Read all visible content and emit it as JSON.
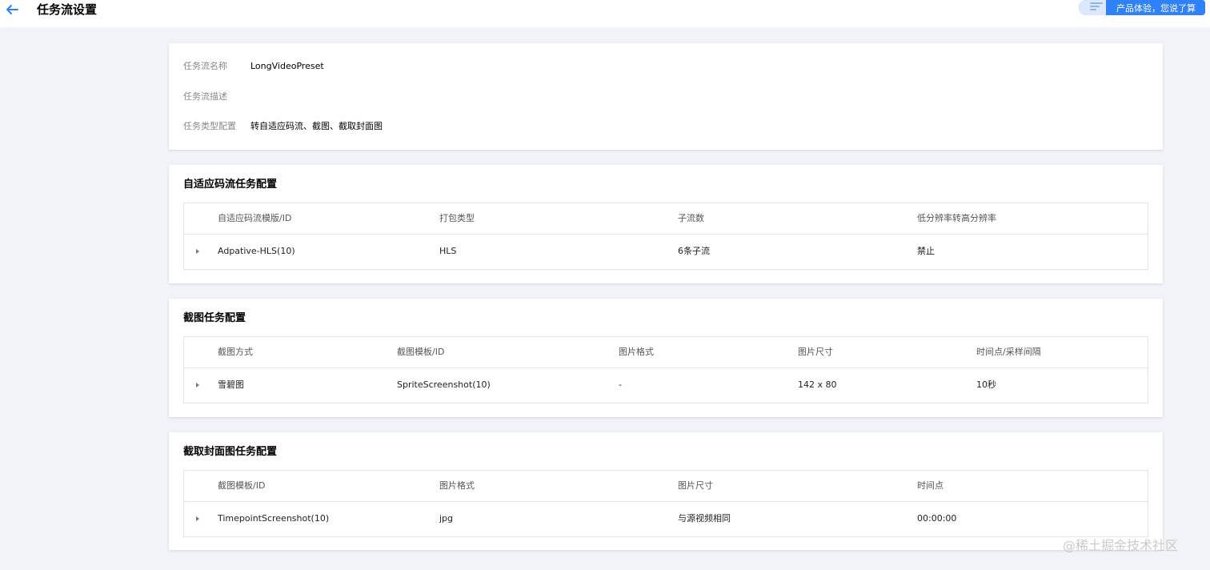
{
  "header": {
    "title": "任务流设置",
    "feedback_label": "产品体验，您说了算"
  },
  "info": {
    "rows": [
      {
        "label": "任务流名称",
        "value": "LongVideoPreset"
      },
      {
        "label": "任务流描述",
        "value": ""
      },
      {
        "label": "任务类型配置",
        "value": "转自适应码流、截图、截取封面图"
      }
    ]
  },
  "adaptive": {
    "title": "自适应码流任务配置",
    "columns": [
      "自适应码流模版/ID",
      "打包类型",
      "子流数",
      "低分辨率转高分辨率"
    ],
    "rows": [
      [
        "Adpative-HLS(10)",
        "HLS",
        "6条子流",
        "禁止"
      ]
    ]
  },
  "screenshot": {
    "title": "截图任务配置",
    "columns": [
      "截图方式",
      "截图模板/ID",
      "图片格式",
      "图片尺寸",
      "时间点/采样间隔"
    ],
    "rows": [
      [
        "雪碧图",
        "SpriteScreenshot(10)",
        "-",
        "142 x 80",
        "10秒"
      ]
    ]
  },
  "cover": {
    "title": "截取封面图任务配置",
    "columns": [
      "截图模板/ID",
      "图片格式",
      "图片尺寸",
      "时间点"
    ],
    "rows": [
      [
        "TimepointScreenshot(10)",
        "jpg",
        "与源视频相同",
        "00:00:00"
      ]
    ]
  },
  "watermark": "@稀土掘金技术社区",
  "colors": {
    "accent": "#2f81f7",
    "background": "#f2f3f8"
  },
  "icons": {
    "back": "arrow-left-icon",
    "expand": "caret-right-icon",
    "feedback": "document-icon"
  }
}
